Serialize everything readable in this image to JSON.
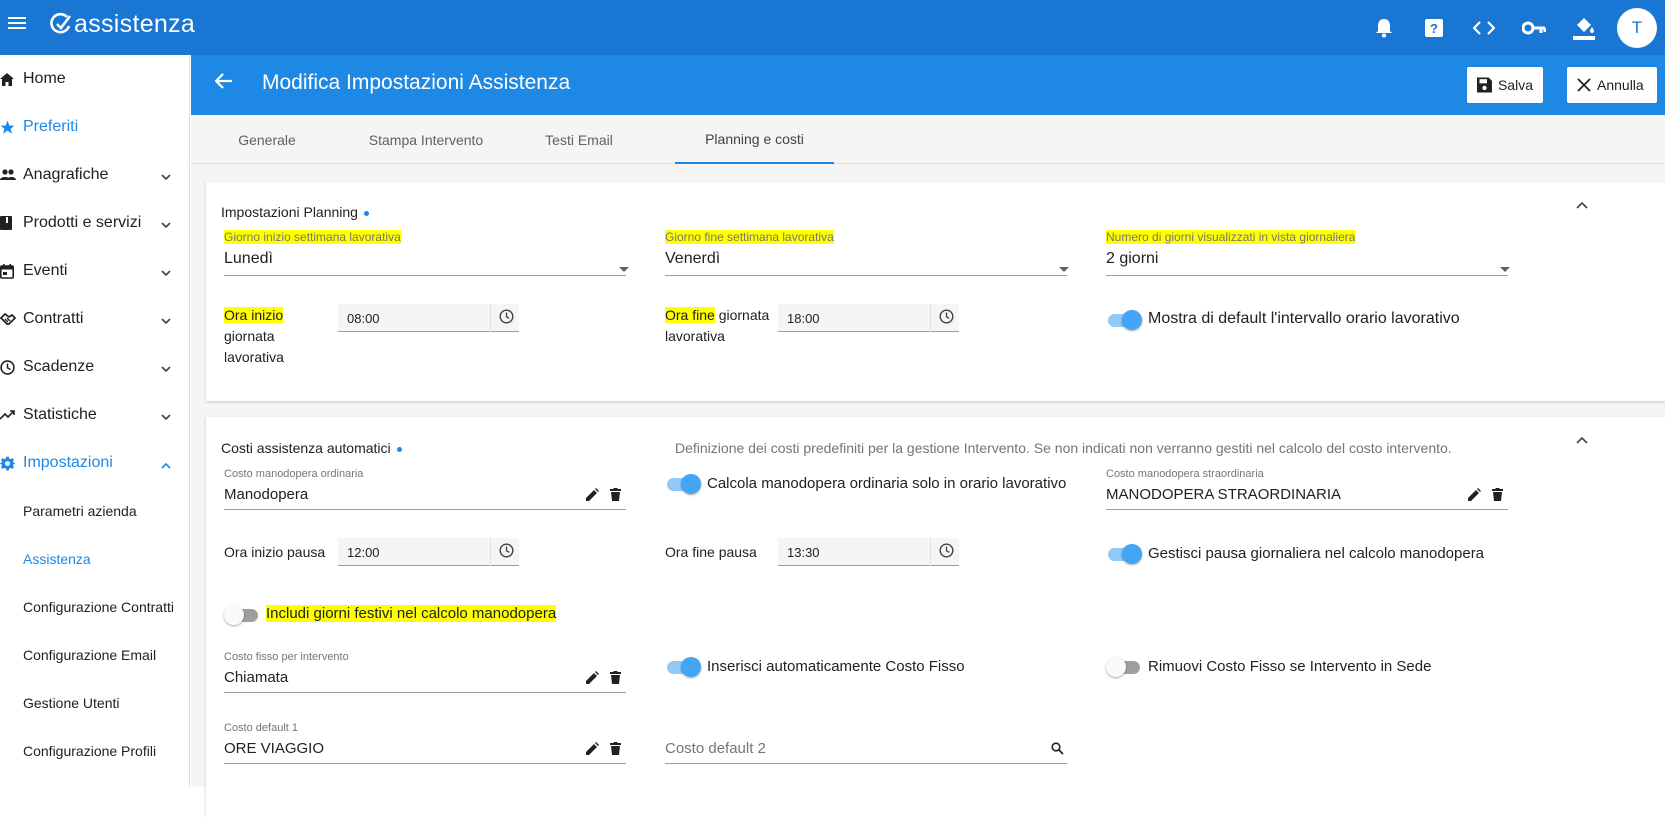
{
  "app": {
    "name": "assistenza",
    "avatar_initial": "T"
  },
  "topbar_icons": [
    "bell-icon",
    "help-icon",
    "code-icon",
    "key-icon",
    "paint-bucket-icon"
  ],
  "sidebar": {
    "items": [
      {
        "label": "Home",
        "icon": "home-icon"
      },
      {
        "label": "Preferiti",
        "icon": "star-icon"
      },
      {
        "label": "Anagrafiche",
        "icon": "people-icon"
      },
      {
        "label": "Prodotti e servizi",
        "icon": "book-icon"
      },
      {
        "label": "Eventi",
        "icon": "calendar-icon"
      },
      {
        "label": "Contratti",
        "icon": "handshake-icon"
      },
      {
        "label": "Scadenze",
        "icon": "clock-icon"
      },
      {
        "label": "Statistiche",
        "icon": "trending-icon"
      },
      {
        "label": "Impostazioni",
        "icon": "gear-icon"
      }
    ],
    "subitems": [
      "Parametri azienda",
      "Assistenza",
      "Configurazione Contratti",
      "Configurazione Email",
      "Gestione Utenti",
      "Configurazione Profili"
    ]
  },
  "header": {
    "title": "Modifica Impostazioni Assistenza",
    "save_label": "Salva",
    "cancel_label": "Annulla"
  },
  "tabs": [
    "Generale",
    "Stampa Intervento",
    "Testi Email",
    "Planning e costi"
  ],
  "planning": {
    "title": "Impostazioni Planning",
    "start_day_label": "Giorno inizio settimana lavorativa",
    "start_day_value": "Lunedì",
    "end_day_label": "Giorno fine settimana lavorativa",
    "end_day_value": "Venerdì",
    "days_label": "Numero di giorni visualizzati in vista giornaliera",
    "days_value": "2 giorni",
    "start_time_label_hl": "Ora inizio",
    "start_time_label_rest1": "giornata",
    "start_time_label_rest2": "lavorativa",
    "start_time_value": "08:00",
    "end_time_label_hl": "Ora fine",
    "end_time_label_rest1": " giornata",
    "end_time_label_rest2": "lavorativa",
    "end_time_value": "18:00",
    "show_interval_label": "Mostra di default l'intervallo orario lavorativo"
  },
  "costs": {
    "title": "Costi assistenza automatici",
    "description": "Definizione dei costi predefiniti per la gestione Intervento. Se non indicati non verranno gestiti nel calcolo del costo intervento.",
    "ordinary_label": "Costo manodopera ordinaria",
    "ordinary_value": "Manodopera",
    "calc_ordinary_label": "Calcola manodopera ordinaria solo in orario lavorativo",
    "extra_label": "Costo manodopera straordinaria",
    "extra_value": "MANODOPERA STRAORDINARIA",
    "pause_start_label": "Ora inizio pausa",
    "pause_start_value": "12:00",
    "pause_end_label": "Ora fine pausa",
    "pause_end_value": "13:30",
    "manage_pause_label": "Gestisci pausa giornaliera nel calcolo manodopera",
    "holidays_label": "Includi giorni festivi nel calcolo manodopera",
    "fixed_label": "Costo fisso per intervento",
    "fixed_value": "Chiamata",
    "auto_fixed_label": "Inserisci automaticamente Costo Fisso",
    "remove_fixed_label": "Rimuovi Costo Fisso se Intervento in Sede",
    "default1_label": "Costo default 1",
    "default1_value": "ORE VIAGGIO",
    "default2_placeholder": "Costo default 2"
  },
  "toggles": {
    "show_interval": true,
    "calc_ordinary": true,
    "manage_pause": true,
    "holidays": false,
    "auto_fixed": true,
    "remove_fixed": false
  },
  "colors": {
    "primary": "#1976d2",
    "header": "#1e88e5",
    "highlight": "#ffff00"
  }
}
